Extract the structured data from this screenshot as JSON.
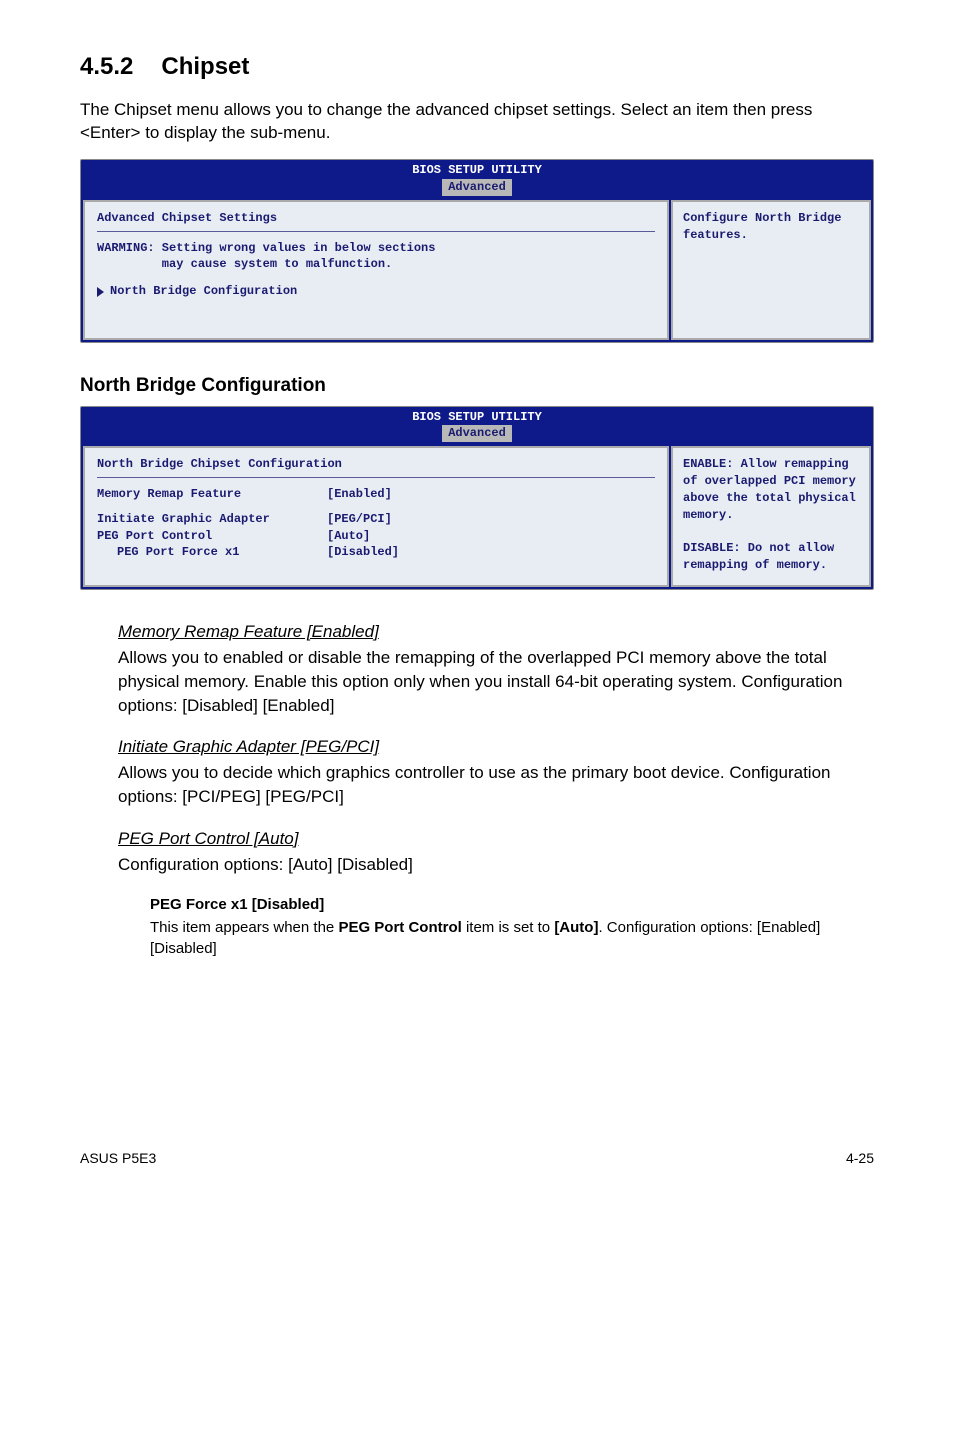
{
  "heading": {
    "num": "4.5.2",
    "title": "Chipset"
  },
  "intro": "The Chipset menu allows you to change the advanced chipset settings. Select an item then press <Enter> to display the sub-menu.",
  "bios1": {
    "header": "BIOS SETUP UTILITY",
    "tab": "Advanced",
    "left_title": "Advanced Chipset Settings",
    "warn1": "WARMING: Setting wrong values in below sections",
    "warn2": "         may cause system to malfunction.",
    "submenu": "North Bridge Configuration",
    "right": "Configure North Bridge features."
  },
  "subheading": "North Bridge Configuration",
  "bios2": {
    "header": "BIOS SETUP UTILITY",
    "tab": "Advanced",
    "left_title": "North Bridge Chipset Configuration",
    "rows": [
      {
        "label": "Memory Remap Feature",
        "value": "[Enabled]",
        "indent": false
      },
      {
        "label": "Initiate Graphic Adapter",
        "value": "[PEG/PCI]",
        "indent": false
      },
      {
        "label": "PEG Port Control",
        "value": "[Auto]",
        "indent": false
      },
      {
        "label": "PEG Port Force x1",
        "value": "[Disabled]",
        "indent": true
      }
    ],
    "right": "ENABLE: Allow remapping of overlapped PCI memory above the total physical memory.\n\nDISABLE: Do not allow remapping of memory."
  },
  "configs": [
    {
      "title": "Memory Remap Feature [Enabled]",
      "body": "Allows you to enabled or disable the remapping of the overlapped PCI memory above the total physical memory. Enable this option only when you install 64-bit operating system. Configuration options: [Disabled] [Enabled]"
    },
    {
      "title": "Initiate Graphic Adapter [PEG/PCI]",
      "body": "Allows you to decide which graphics controller to use as the primary boot device. Configuration options: [PCI/PEG] [PEG/PCI]"
    },
    {
      "title": "PEG Port Control [Auto]",
      "body": "Configuration options: [Auto] [Disabled]"
    }
  ],
  "pegsub": {
    "title": "PEG Force x1 [Disabled]",
    "body_pre": "This item appears when the ",
    "body_b1": "PEG Port Control",
    "body_mid": " item is set to ",
    "body_b2": "[Auto]",
    "body_post": ". Configuration options: [Enabled] [Disabled]"
  },
  "footer": {
    "left": "ASUS P5E3",
    "right": "4-25"
  }
}
